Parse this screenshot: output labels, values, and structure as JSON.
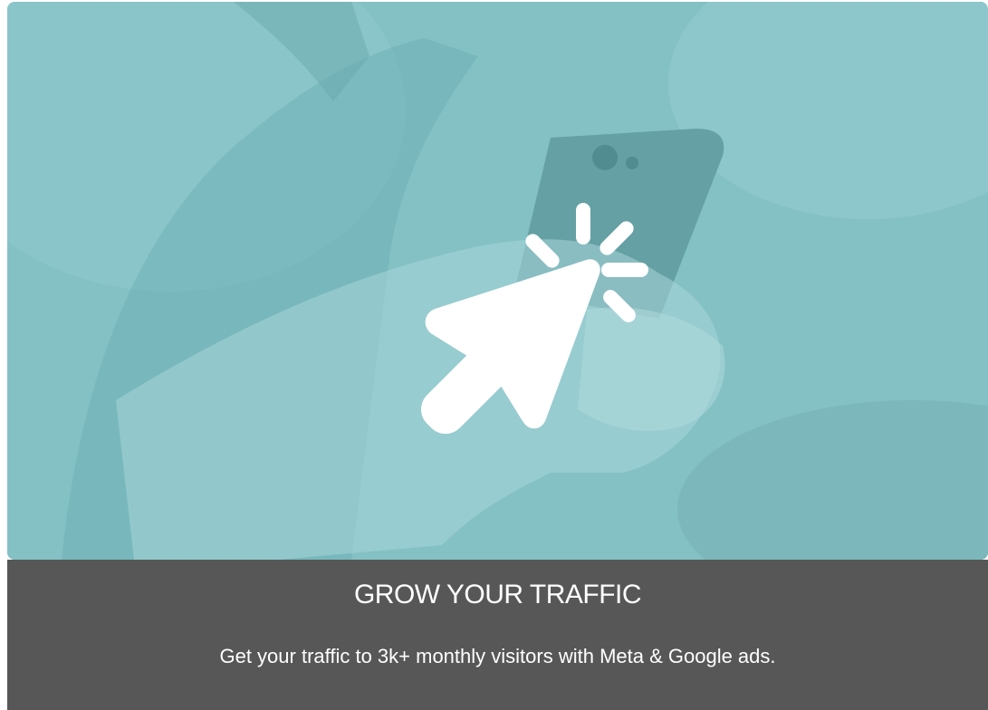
{
  "hero": {
    "icon": "cursor-click-icon",
    "overlay_color": "#7dbcc0"
  },
  "caption": {
    "title": "GROW YOUR TRAFFIC",
    "text": "Get your traffic to 3k+ monthly visitors with Meta & Google ads.",
    "background_color": "#575758"
  }
}
